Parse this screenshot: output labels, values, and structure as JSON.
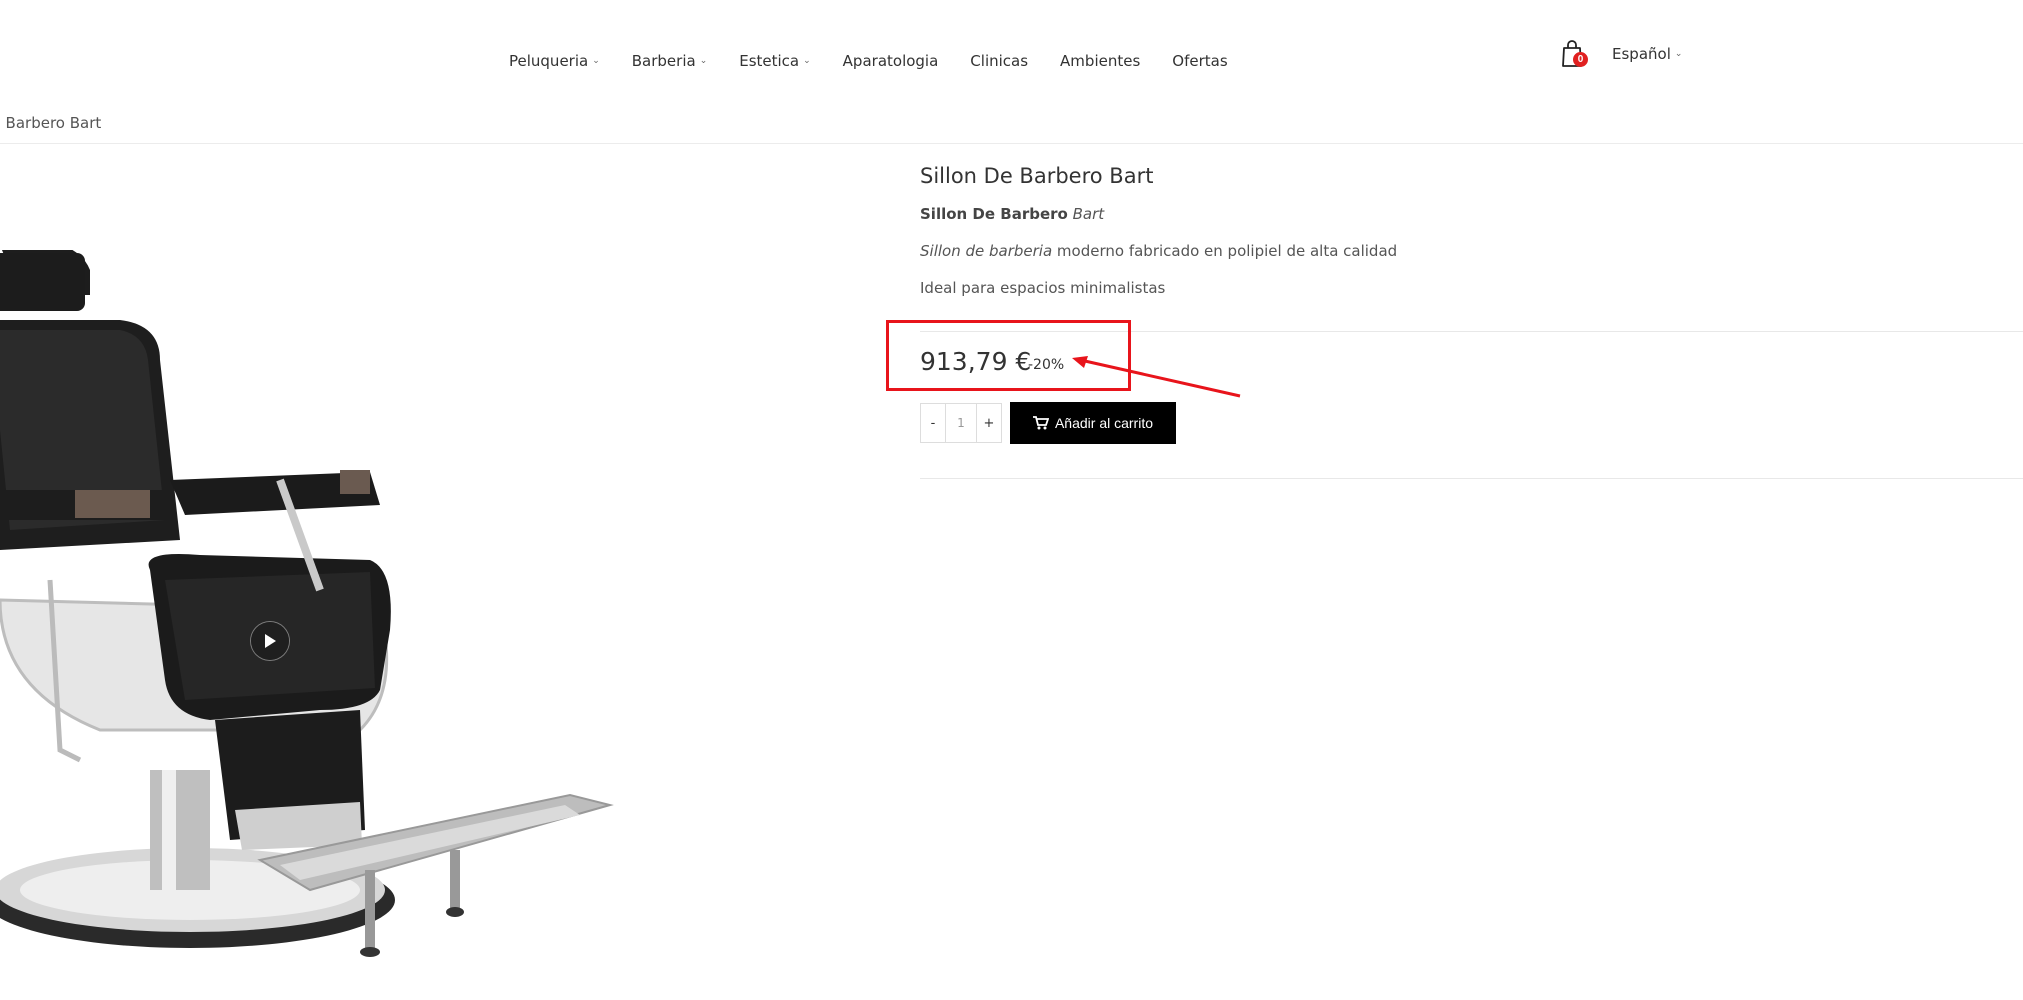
{
  "nav": {
    "items": [
      {
        "label": "Peluqueria",
        "dropdown": true
      },
      {
        "label": "Barberia",
        "dropdown": true
      },
      {
        "label": "Estetica",
        "dropdown": true
      },
      {
        "label": "Aparatologia",
        "dropdown": false
      },
      {
        "label": "Clinicas",
        "dropdown": false
      },
      {
        "label": "Ambientes",
        "dropdown": false
      },
      {
        "label": "Ofertas",
        "dropdown": false
      }
    ],
    "cart_count": "0",
    "language": "Español",
    "chevron": "⌄"
  },
  "breadcrumb": {
    "current": "De Barbero Bart"
  },
  "product": {
    "title": "Sillon De Barbero Bart",
    "desc1_bold": "Sillon De Barbero",
    "desc1_italic": "Bart",
    "desc2_italic": "Sillon de barberia",
    "desc2_rest": " moderno fabricado en polipiel de alta calidad",
    "desc3": "Ideal para espacios minimalistas",
    "price": "913,79 €",
    "discount": "-20%",
    "quantity": "1",
    "qty_minus": "-",
    "qty_plus": "+",
    "add_to_cart": "Añadir al carrito"
  },
  "colors": {
    "accent": "#e8141b",
    "button": "#000000",
    "badge": "#e02020"
  },
  "icons": [
    "shopping-bag-icon",
    "chevron-down-icon",
    "cart-icon",
    "play-icon"
  ]
}
